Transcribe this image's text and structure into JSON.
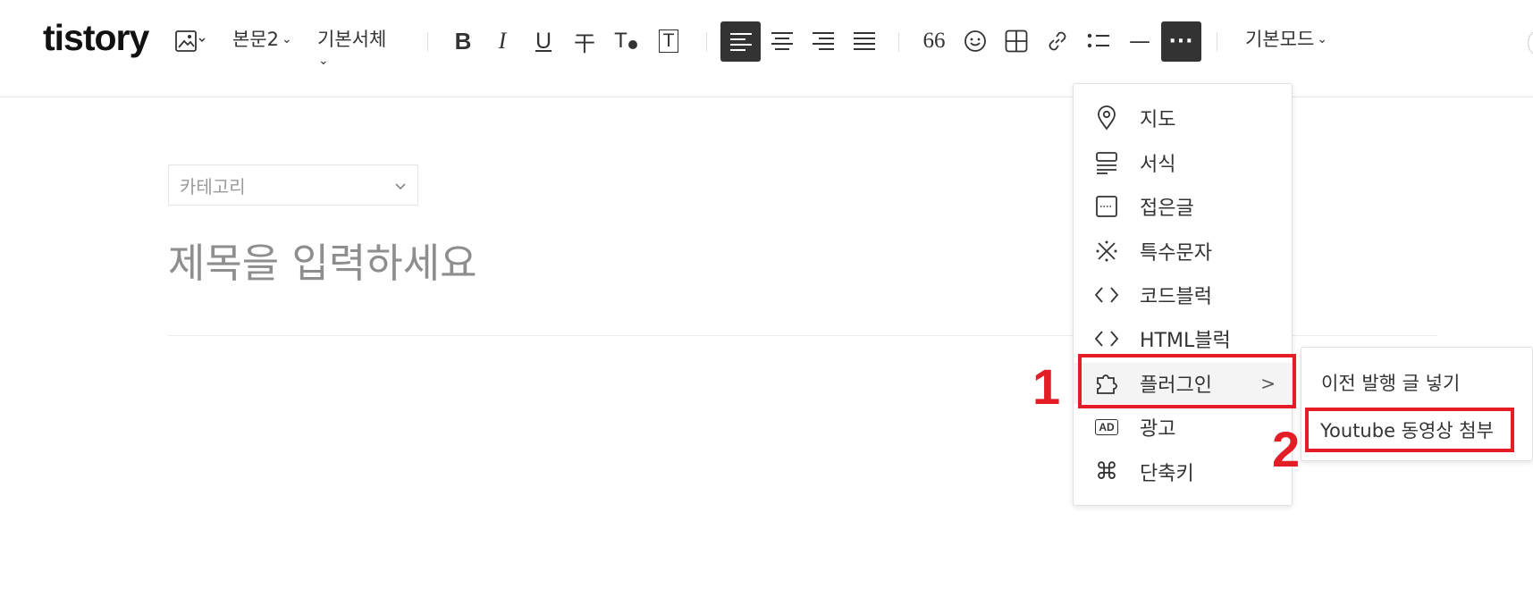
{
  "toolbar": {
    "logo": "tistory",
    "image_icon": "image-icon",
    "paragraph_style": "본문2",
    "font_face": "기본서체",
    "bold": "B",
    "italic": "I",
    "underline": "U",
    "strike": "干",
    "text_color": "T",
    "text_bg": "T",
    "align_left_icon": "align-left-icon",
    "align_center_icon": "align-center-icon",
    "align_right_icon": "align-right-icon",
    "align_justify_icon": "align-justify-icon",
    "quote": "66",
    "emoji_icon": "emoji-icon",
    "table_icon": "table-icon",
    "link_icon": "link-icon",
    "list_icon": "list-icon",
    "divider": "—",
    "more": "···",
    "mode": "기본모드",
    "accent_color": "#333333"
  },
  "editor": {
    "category_placeholder": "카테고리",
    "title_placeholder": "제목을 입력하세요"
  },
  "menu": {
    "items": [
      {
        "label": "지도",
        "icon": "map-pin-icon"
      },
      {
        "label": "서식",
        "icon": "template-icon"
      },
      {
        "label": "접은글",
        "icon": "fold-icon"
      },
      {
        "label": "특수문자",
        "icon": "special-char-icon"
      },
      {
        "label": "코드블럭",
        "icon": "code-icon"
      },
      {
        "label": "HTML블럭",
        "icon": "html-icon"
      },
      {
        "label": "플러그인",
        "icon": "plugin-icon",
        "arrow": ">"
      },
      {
        "label": "광고",
        "icon": "ad-icon",
        "icon_text": "AD"
      },
      {
        "label": "단축키",
        "icon": "command-icon",
        "icon_text": "⌘"
      }
    ]
  },
  "submenu": {
    "items": [
      {
        "label": "이전 발행 글 넣기"
      },
      {
        "label": "Youtube 동영상 첨부"
      }
    ]
  },
  "annotations": {
    "step1": "1",
    "step2": "2",
    "color": "#e41e26"
  }
}
